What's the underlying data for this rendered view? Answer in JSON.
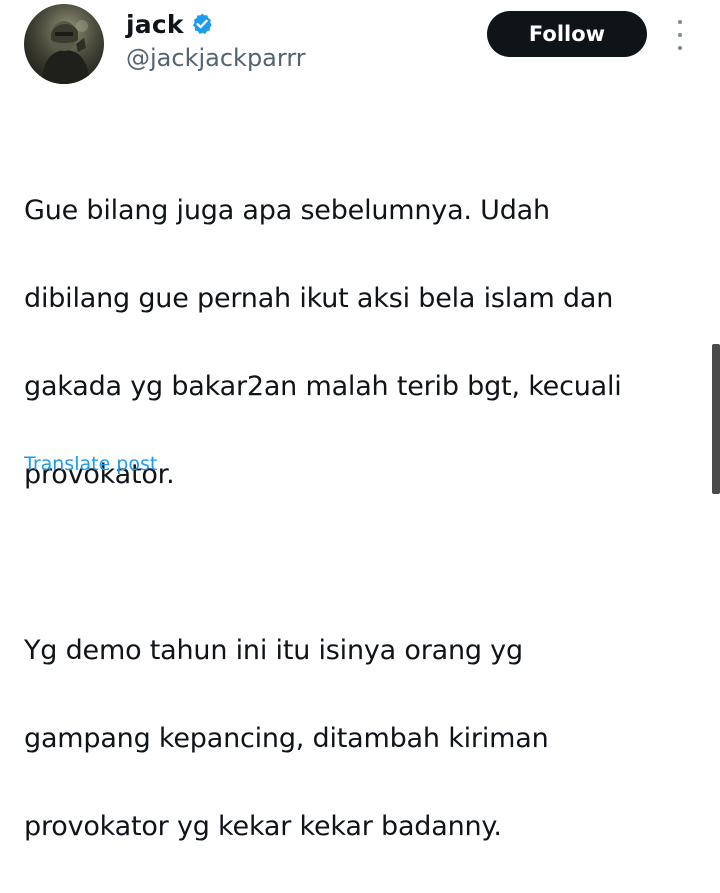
{
  "user": {
    "display_name": "jack",
    "handle": "@jackjackparrr",
    "verified": true
  },
  "actions": {
    "follow_label": "Follow"
  },
  "tweet": {
    "paragraph_1_lines": [
      "Gue bilang juga apa sebelumnya. Udah",
      "dibilang gue pernah ikut aksi bela islam dan",
      "gakada yg bakar2an malah terib bgt, kecuali",
      "provokator."
    ],
    "paragraph_2_lines": [
      "Yg demo tahun ini itu isinya orang yg",
      "gampang kepancing, ditambah kiriman",
      "provokator yg kekar kekar badanny."
    ],
    "translate_label": "Translate post"
  },
  "icons": {
    "verified": "verified-badge-icon",
    "more": "more-options-icon",
    "avatar": "profile-photo"
  },
  "colors": {
    "text": "#0f1419",
    "secondary": "#536471",
    "link": "#1d9bf0",
    "verified": "#1d9bf0",
    "follow_bg": "#0f1419",
    "follow_text": "#ffffff"
  }
}
